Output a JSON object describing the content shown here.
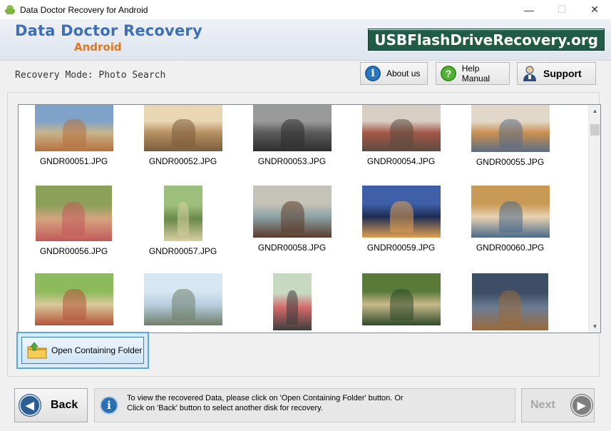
{
  "window": {
    "title": "Data Doctor Recovery for Android",
    "controls": {
      "minimize": "—",
      "maximize": "☐",
      "close": "✕"
    }
  },
  "banner": {
    "product_name": "Data Doctor Recovery",
    "product_sub": "Android",
    "brand": "USBFlashDriveRecovery.org"
  },
  "mode": {
    "label": "Recovery Mode: Photo Search"
  },
  "toolbar": {
    "about_label": "About us",
    "help_label": "Help Manual",
    "support_label": "Support"
  },
  "gallery": {
    "items": [
      {
        "file": "GNDR00051.JPG",
        "colors": [
          "#7fa2c8",
          "#c7b48a",
          "#b5713f"
        ]
      },
      {
        "file": "GNDR00052.JPG",
        "colors": [
          "#e9d6b3",
          "#b59063",
          "#7b5d3c"
        ]
      },
      {
        "file": "GNDR00053.JPG",
        "colors": [
          "#9a9a9a",
          "#5b5b5b",
          "#2e2e2e"
        ]
      },
      {
        "file": "GNDR00054.JPG",
        "colors": [
          "#d8cfc4",
          "#a35848",
          "#5b4a3f"
        ]
      },
      {
        "file": "GNDR00055.JPG",
        "colors": [
          "#e2d8c9",
          "#c98e4f",
          "#5b6e84"
        ]
      },
      {
        "file": "GNDR00056.JPG",
        "colors": [
          "#8ca05a",
          "#d4a37f",
          "#c25a5a"
        ]
      },
      {
        "file": "GNDR00057.JPG",
        "colors": [
          "#9dbf7c",
          "#6a8a4a",
          "#d8cfa0"
        ]
      },
      {
        "file": "GNDR00058.JPG",
        "colors": [
          "#c5c2b8",
          "#8aa3a6",
          "#5b3a2a"
        ]
      },
      {
        "file": "GNDR00059.JPG",
        "colors": [
          "#3f5fa8",
          "#1e2d55",
          "#e0a050"
        ]
      },
      {
        "file": "GNDR00060.JPG",
        "colors": [
          "#c99a55",
          "#e8d2b0",
          "#4a6a8a"
        ]
      },
      {
        "file": "",
        "colors": [
          "#8cba5c",
          "#d9c99a",
          "#b3543a"
        ]
      },
      {
        "file": "",
        "colors": [
          "#d6e6f2",
          "#b8cfe0",
          "#6f7f6a"
        ]
      },
      {
        "file": "",
        "colors": [
          "#c8d9c2",
          "#d46a6a",
          "#3d3d3d"
        ]
      },
      {
        "file": "",
        "colors": [
          "#5a7a3a",
          "#c9b98a",
          "#2f4a2a"
        ]
      },
      {
        "file": "",
        "colors": [
          "#3e4e66",
          "#6b7d93",
          "#9a6a3a"
        ]
      }
    ]
  },
  "actions": {
    "open_folder_label": "Open Containing Folder"
  },
  "footer": {
    "back_label": "Back",
    "next_label": "Next",
    "info_line1": "To view the recovered Data, please click on 'Open Containing Folder' button. Or",
    "info_line2": "Click on 'Back' button to select another disk for recovery."
  }
}
